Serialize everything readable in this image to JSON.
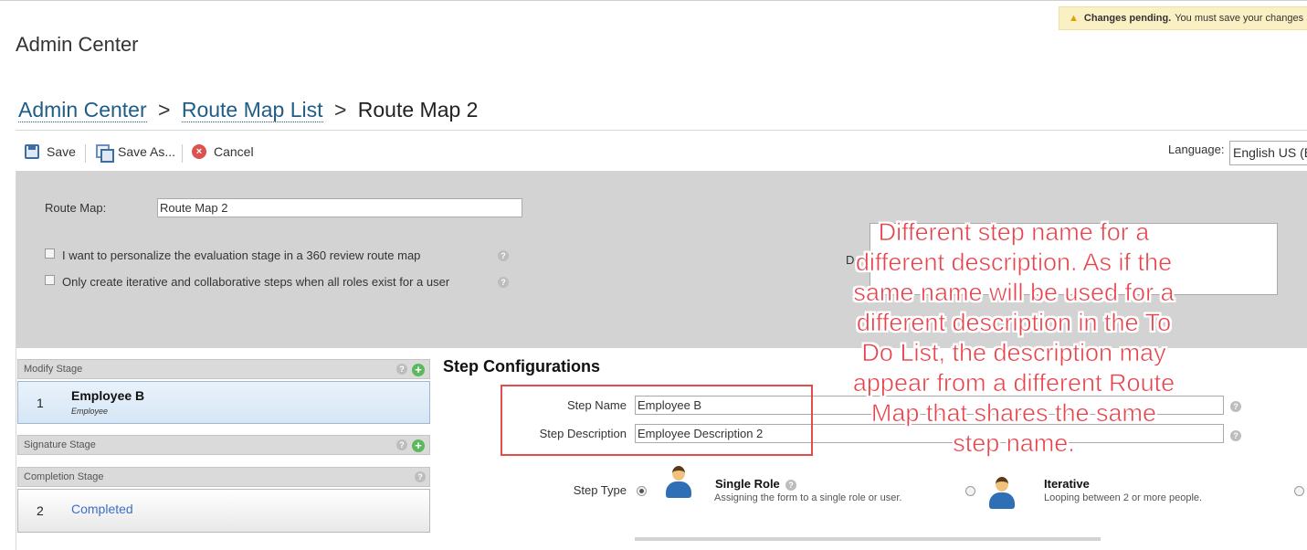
{
  "notice": {
    "bold": "Changes pending.",
    "text": "You must save your changes"
  },
  "app_title": "Admin Center",
  "breadcrumb": {
    "items": [
      "Admin Center",
      "Route Map List"
    ],
    "separator": ">",
    "current": "Route Map 2"
  },
  "toolbar": {
    "save_label": "Save",
    "save_as_label": "Save As...",
    "cancel_label": "Cancel",
    "language_label": "Language:",
    "language_value": "English US (E"
  },
  "route_map": {
    "label": "Route Map:",
    "value": "Route Map 2",
    "options": [
      "I want to personalize the evaluation stage in a 360 review route map",
      "Only create iterative and collaborative steps when all roles exist for a user"
    ],
    "description_label": "De"
  },
  "stages": {
    "modify": {
      "title": "Modify Stage",
      "step_number": "1",
      "step_name": "Employee B",
      "step_role": "Employee"
    },
    "signature": {
      "title": "Signature Stage"
    },
    "completion": {
      "title": "Completion Stage",
      "step_number": "2",
      "step_name": "Completed"
    }
  },
  "step_config": {
    "title": "Step Configurations",
    "name_label": "Step Name",
    "name_value": "Employee B",
    "description_label": "Step Description",
    "description_value": "Employee Description 2",
    "type_label": "Step Type",
    "single_role": {
      "title": "Single Role",
      "subtitle": "Assigning the form to a single role or user."
    },
    "iterative": {
      "title": "Iterative",
      "subtitle": "Looping between 2 or more people."
    }
  },
  "annotation": "Different step name for a different description. As if the same name will be used for a different description in the To Do List, the description may appear from a different Route Map that shares the same step name.",
  "colors": {
    "annotation": "#e8434c",
    "link": "#1f5d86",
    "highlight_box": "#e24c4c",
    "pending_bg": "#fbf0c4"
  }
}
